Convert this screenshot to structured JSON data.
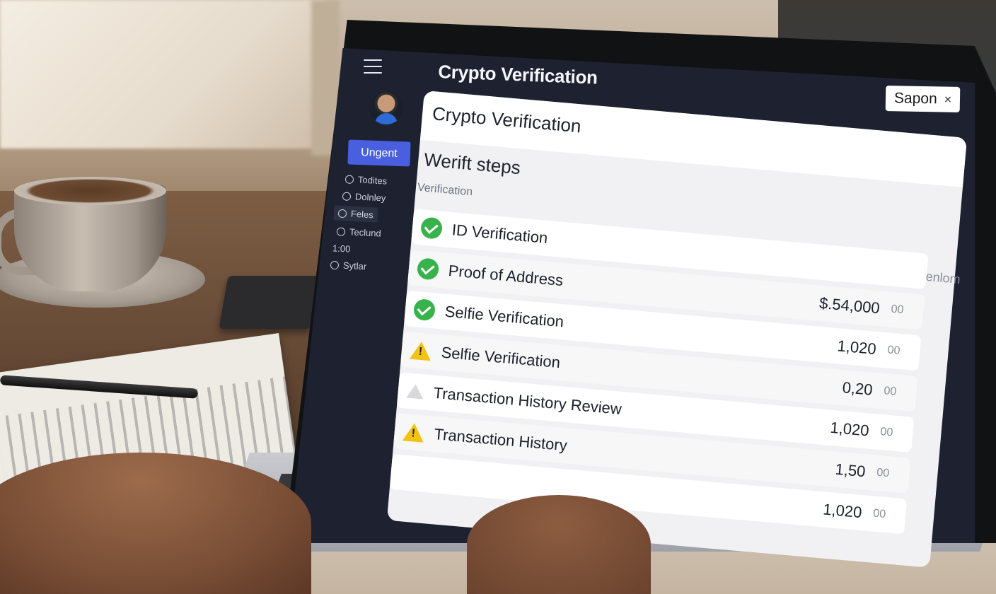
{
  "app": {
    "title": "Crypto Verification"
  },
  "user": {
    "name": "Sapon",
    "close_glyph": "×"
  },
  "sidebar": {
    "urgent_label": "Ungent",
    "items": [
      {
        "label": "Todites"
      },
      {
        "label": "Dolnley"
      },
      {
        "label": "Feles"
      },
      {
        "label": "Teclund"
      },
      {
        "label": "1:00"
      },
      {
        "label": "Sytlar"
      }
    ]
  },
  "card": {
    "title": "Crypto Verification",
    "steps_title": "Werift steps",
    "steps_subtitle": "Verification",
    "column_header": "For Inenlom",
    "rows": [
      {
        "label": "ID Verification",
        "status": "ok",
        "amount": "",
        "unit": ""
      },
      {
        "label": "Proof of Address",
        "status": "ok",
        "amount": "$.54,000",
        "unit": "00"
      },
      {
        "label": "Selfie Verification",
        "status": "ok",
        "amount": "1,020",
        "unit": "00"
      },
      {
        "label": "Selfie Verification",
        "status": "warning",
        "amount": "0,20",
        "unit": "00"
      },
      {
        "label": "Transaction History Review",
        "status": "pending",
        "amount": "1,020",
        "unit": "00"
      },
      {
        "label": "Transaction History",
        "status": "warning",
        "amount": "1,50",
        "unit": "00"
      },
      {
        "label": "",
        "status": "none",
        "amount": "1,020",
        "unit": "00"
      }
    ]
  },
  "colors": {
    "accent": "#4a5fe0",
    "success": "#38b24a",
    "warning": "#f2c315",
    "sidebar_bg": "#1d2130"
  }
}
